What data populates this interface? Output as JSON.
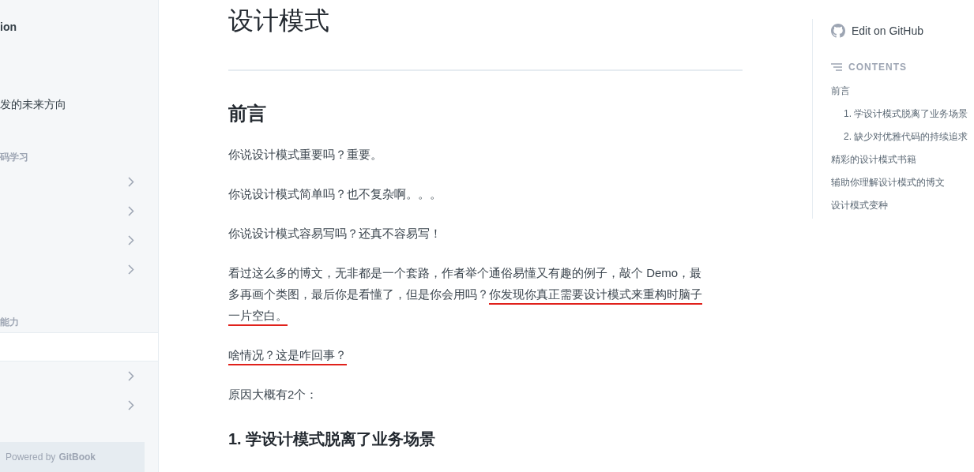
{
  "sidebar": {
    "items": [
      {
        "kind": "link",
        "label": "ion",
        "bold": true,
        "selected": false
      },
      {
        "kind": "link",
        "label": "发的未来方向",
        "bold": false,
        "selected": false
      },
      {
        "kind": "header",
        "label": "码学习"
      },
      {
        "kind": "chevron",
        "selected": false
      },
      {
        "kind": "chevron",
        "selected": false
      },
      {
        "kind": "chevron",
        "selected": false
      },
      {
        "kind": "chevron",
        "selected": false
      },
      {
        "kind": "header",
        "label": "能力"
      },
      {
        "kind": "blank",
        "selected": true
      },
      {
        "kind": "chevron",
        "selected": false
      },
      {
        "kind": "chevron",
        "selected": false
      }
    ],
    "footer": {
      "prefix": "Powered by",
      "brand": "GitBook"
    }
  },
  "article": {
    "title": "设计模式",
    "blocks": [
      {
        "kind": "h2",
        "parts": [
          {
            "text": "前言",
            "underlined": false
          }
        ]
      },
      {
        "kind": "p",
        "parts": [
          {
            "text": "你说设计模式重要吗？重要。",
            "underlined": false
          }
        ]
      },
      {
        "kind": "p",
        "parts": [
          {
            "text": "你说设计模式简单吗？也不复杂啊。。。",
            "underlined": false
          }
        ]
      },
      {
        "kind": "p",
        "parts": [
          {
            "text": "你说设计模式容易写吗？还真不容易写！",
            "underlined": false
          }
        ]
      },
      {
        "kind": "p",
        "parts": [
          {
            "text": "看过这么多的博文，无非都是一个套路，作者举个通俗易懂又有趣的例子，敲个 Demo，最多再画个类图，最后你是看懂了，但是你会用吗？",
            "underlined": false
          },
          {
            "text": "你发现你真正需要设计模式来重构时脑子一片空白。",
            "underlined": true
          }
        ]
      },
      {
        "kind": "p",
        "parts": [
          {
            "text": "啥情况？这是咋回事？",
            "underlined": true
          }
        ]
      },
      {
        "kind": "p",
        "parts": [
          {
            "text": "原因大概有2个：",
            "underlined": false
          }
        ]
      },
      {
        "kind": "h3",
        "parts": [
          {
            "text": "1. 学设计模式脱离了业务场景",
            "underlined": false
          }
        ]
      }
    ]
  },
  "toc": {
    "edit_label": "Edit on GitHub",
    "heading": "CONTENTS",
    "items": [
      {
        "label": "前言",
        "children": [
          {
            "label": "1. 学设计模式脱离了业务场景"
          },
          {
            "label": "2. 缺少对优雅代码的持续追求"
          }
        ]
      },
      {
        "label": "精彩的设计模式书籍"
      },
      {
        "label": "辅助你理解设计模式的博文"
      },
      {
        "label": "设计模式变种"
      }
    ]
  }
}
